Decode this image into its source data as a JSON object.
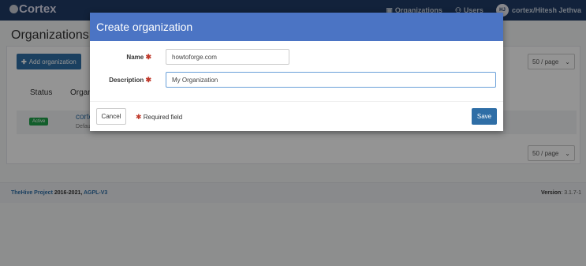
{
  "navbar": {
    "brand": "Cortex",
    "links": [
      {
        "label": "Organizations",
        "icon": "building-icon"
      },
      {
        "label": "Users",
        "icon": "users-icon"
      }
    ],
    "avatar_initials": "HJ",
    "user": "cortex/Hitesh Jethva"
  },
  "page": {
    "title": "Organizations (1)",
    "add_button": "Add organization",
    "per_page": "50 / page",
    "columns": [
      "Status",
      "Organi"
    ],
    "rows": [
      {
        "status": "Active",
        "name": "cortex",
        "description": "Default"
      }
    ]
  },
  "footer": {
    "project": "TheHive Project",
    "years": "2016-2021,",
    "license": "AGPL-V3",
    "version_label": "Version",
    "version": ": 3.1.7-1"
  },
  "modal": {
    "title": "Create organization",
    "name_label": "Name",
    "name_value": "howtoforge.com",
    "description_label": "Description",
    "description_value": "My Organization",
    "cancel": "Cancel",
    "required_note": "Required field",
    "save": "Save"
  },
  "colors": {
    "navbar": "#1f3c66",
    "modal_header": "#4b74c4",
    "primary": "#2f6ea6",
    "active_badge": "#1fa34a",
    "required": "#c0392b"
  }
}
